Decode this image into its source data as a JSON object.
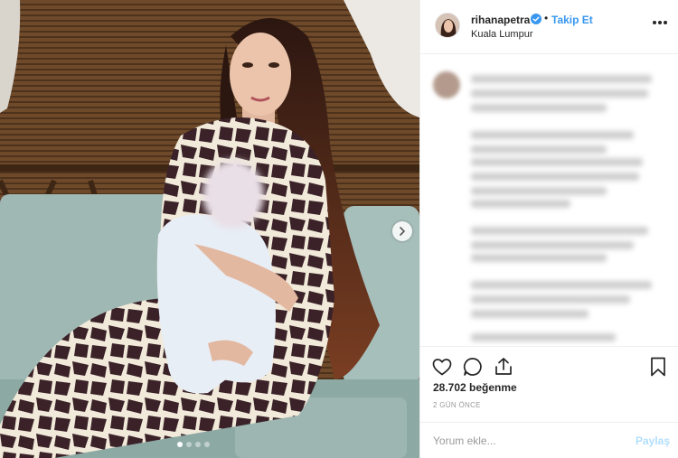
{
  "post": {
    "image": {
      "alt": "",
      "carousel_dots": 4,
      "active_dot": 1
    },
    "header": {
      "username": "rihanapetra",
      "separator": "•",
      "follow_label": "Takip Et",
      "location": "Kuala Lumpur"
    },
    "likes_text": "28.702 beğenme",
    "date_text": "2 GÜN ÖNCE",
    "comment_box": {
      "placeholder": "Yorum ekle...",
      "submit_label": "Paylaş"
    }
  },
  "icons": {
    "verified": "verified-badge-icon",
    "more": "more-options-icon",
    "like": "heart-icon",
    "comment": "comment-icon",
    "share": "share-icon",
    "save": "bookmark-icon",
    "next": "chevron-right-icon"
  },
  "colors": {
    "link_blue": "#3897f0",
    "disabled_blue": "#b2dffc",
    "muted_text": "#999999",
    "text": "#262626",
    "divider": "#efefef"
  }
}
